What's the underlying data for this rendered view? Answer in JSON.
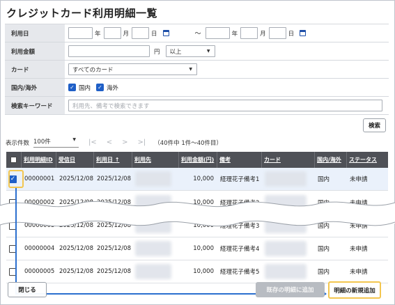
{
  "title": "クレジットカード利用明細一覧",
  "form": {
    "usage_date_label": "利用日",
    "year": "年",
    "month": "月",
    "day": "日",
    "range_sep": "～",
    "amount_label": "利用金額",
    "yen": "円",
    "amount_cond": "以上",
    "card_label": "カード",
    "card_value": "すべてのカード",
    "region_label": "国内/海外",
    "domestic": "国内",
    "overseas": "海外",
    "keyword_label": "検索キーワード",
    "keyword_placeholder": "利用先、備考で検索できます"
  },
  "search_button": "検索",
  "pager": {
    "count_label": "表示件数",
    "count_value": "100件",
    "range": "（40件中 1件〜40件目）",
    "nav": [
      "|<",
      "<",
      ">",
      ">|"
    ]
  },
  "table": {
    "headers": [
      "利用明細ID",
      "受信日",
      "利用日 ↑",
      "利用先",
      "利用金額(円)",
      "備考",
      "カード",
      "国内/海外",
      "ステータス"
    ],
    "rows": [
      {
        "checked": true,
        "id": "00000001",
        "recv": "2025/12/08",
        "used": "2025/12/08",
        "amount": "10,000",
        "note": "経理花子備考1",
        "region": "国内",
        "status": "未申請"
      },
      {
        "checked": false,
        "id": "00000002",
        "recv": "2025/12/08",
        "used": "2025/12/08",
        "amount": "10,000",
        "note": "経理花子備考2",
        "region": "国内",
        "status": "未申請"
      },
      {
        "checked": false,
        "id": "00000003",
        "recv": "2025/12/08",
        "used": "2025/12/08",
        "amount": "10,000",
        "note": "経理花子備考3",
        "region": "国内",
        "status": "未申請"
      },
      {
        "checked": false,
        "id": "00000004",
        "recv": "2025/12/08",
        "used": "2025/12/08",
        "amount": "10,000",
        "note": "経理花子備考4",
        "region": "国内",
        "status": "未申請"
      },
      {
        "checked": false,
        "id": "00000005",
        "recv": "2025/12/08",
        "used": "2025/12/08",
        "amount": "10,000",
        "note": "経理花子備考5",
        "region": "国内",
        "status": "未申請"
      }
    ]
  },
  "footer": {
    "close": "閉じる",
    "add_existing": "既存の明細に追加",
    "add_new": "明細の新規追加"
  },
  "colors": {
    "accent": "#1f5fc7",
    "header_bg": "#4f5157",
    "highlight": "#f3c64f"
  }
}
